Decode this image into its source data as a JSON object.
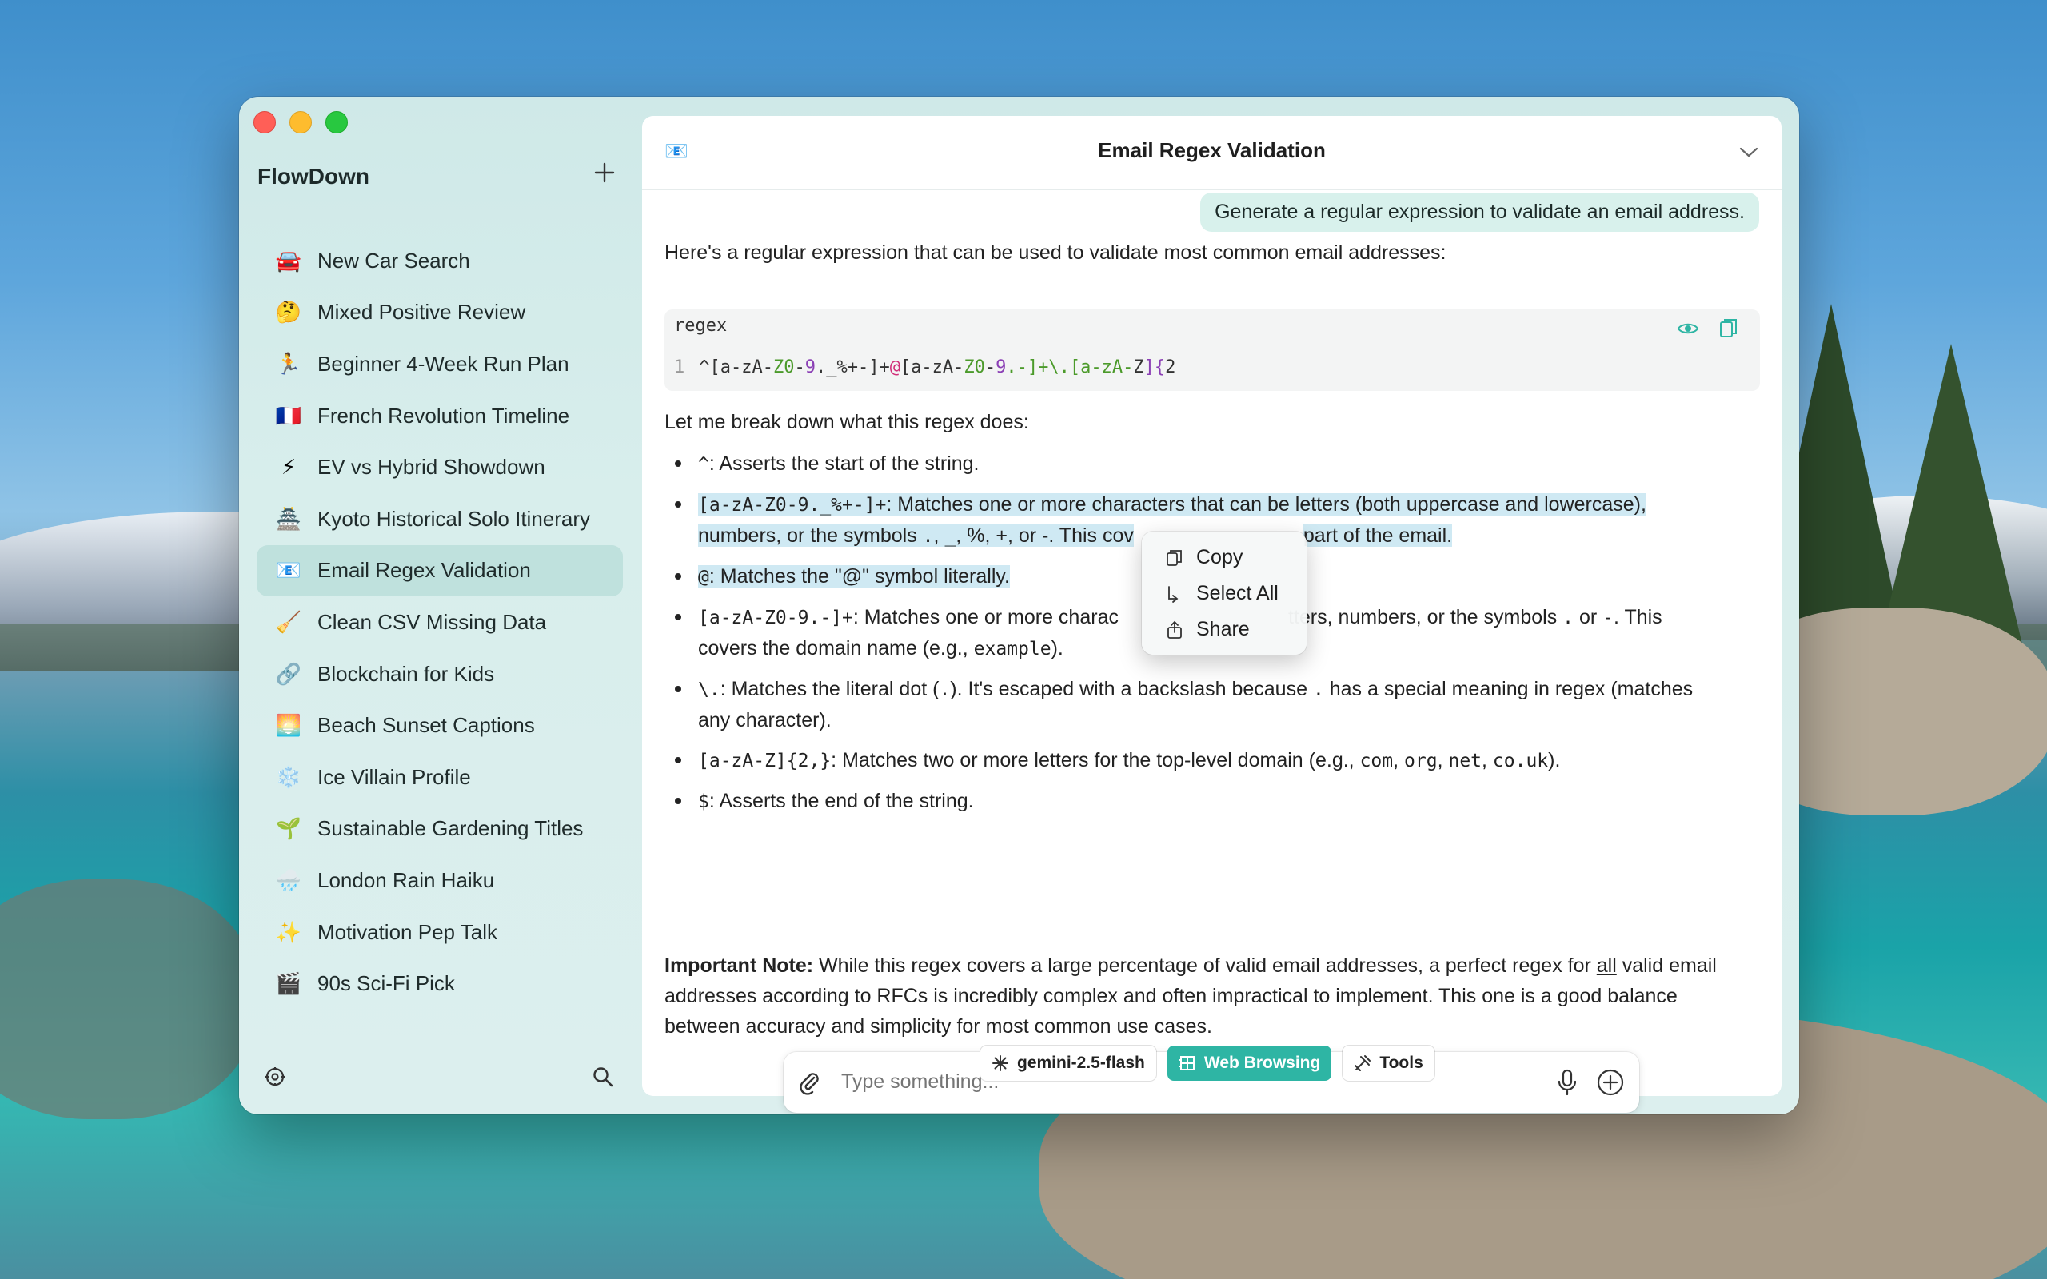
{
  "app": {
    "name": "FlowDown"
  },
  "sidebar": {
    "items": [
      {
        "emoji": "🚘",
        "label": "New Car Search"
      },
      {
        "emoji": "🤔",
        "label": "Mixed Positive Review"
      },
      {
        "emoji": "🏃",
        "label": "Beginner 4-Week Run Plan"
      },
      {
        "emoji": "🇫🇷",
        "label": "French Revolution Timeline"
      },
      {
        "emoji": "⚡",
        "label": "EV vs Hybrid Showdown"
      },
      {
        "emoji": "🏯",
        "label": "Kyoto Historical Solo Itinerary"
      },
      {
        "emoji": "📧",
        "label": "Email Regex Validation"
      },
      {
        "emoji": "🧹",
        "label": "Clean CSV Missing Data"
      },
      {
        "emoji": "🔗",
        "label": "Blockchain for Kids"
      },
      {
        "emoji": "🌅",
        "label": "Beach Sunset Captions"
      },
      {
        "emoji": "❄️",
        "label": "Ice Villain Profile"
      },
      {
        "emoji": "🌱",
        "label": "Sustainable Gardening Titles"
      },
      {
        "emoji": "🌧️",
        "label": "London Rain Haiku"
      },
      {
        "emoji": "✨",
        "label": "Motivation Pep Talk"
      },
      {
        "emoji": "🎬",
        "label": "90s Sci-Fi Pick"
      }
    ],
    "active_index": 6
  },
  "header": {
    "icon": "📧",
    "title": "Email Regex Validation"
  },
  "chat": {
    "user_message": "Generate a regular expression to validate an email address.",
    "intro": "Here's a regular expression that can be used to validate most common email addresses:",
    "code": {
      "lang": "regex",
      "line_number": "1",
      "parts": [
        "^[a-zA-",
        "Z0",
        "-",
        "9",
        "._%+-]+",
        "@",
        "[a-zA-",
        "Z0",
        "-",
        "9",
        ".-]+\\.[a-zA-",
        "Z",
        "]{",
        "2",
        ",}$"
      ]
    },
    "breakdown_intro": "Let me break down what this regex does:",
    "bullets": {
      "b1_code": "^",
      "b1_text": ": Asserts the start of the string.",
      "b2_code": "[a-zA-Z0-9._%+-]+",
      "b2_text1": ": Matches one or more characters that can be letters (both uppercase and lowercase),",
      "b2_text2a": "numbers, or the symbols ",
      "b2_dot": ".",
      "b2_sep1": ", ",
      "b2_us": "_",
      "b2_sep2": ", ",
      "b2_pct": "%",
      "b2_sep3": ", ",
      "b2_plus": "+",
      "b2_sep4": ", or ",
      "b2_minus": "-",
      "b2_text2b": ". This cov",
      "b2_text2c": "part of the email.",
      "b3_code": "@",
      "b3_text": ": Matches the \"@\" symbol literally.",
      "b4_code": "[a-zA-Z0-9.-]+",
      "b4_text1a": ": Matches one or more charac",
      "b4_text1b": "tters, numbers, or the symbols ",
      "b4_dot": ".",
      "b4_or": " or ",
      "b4_minus": "-",
      "b4_text1c": ". This",
      "b4_text2a": "covers the domain name (e.g., ",
      "b4_example": "example",
      "b4_text2b": ").",
      "b5_code": "\\.",
      "b5_text1a": ": Matches the literal dot (",
      "b5_dot": ".",
      "b5_text1b": "). It's escaped with a backslash because ",
      "b5_dot2": ".",
      "b5_text1c": " has a special meaning in regex (matches",
      "b5_text2": "any character).",
      "b6_code": "[a-zA-Z]{2,}",
      "b6_text1": ": Matches two or more letters for the top-level domain (e.g., ",
      "b6_com": "com",
      "b6_sep1": ", ",
      "b6_org": "org",
      "b6_sep2": ", ",
      "b6_net": "net",
      "b6_sep3": ", ",
      "b6_couk": "co.uk",
      "b6_text2": ").",
      "b7_code": "$",
      "b7_text": ": Asserts the end of the string."
    },
    "note_label": "Important Note:",
    "note_line1a": " While this regex covers a large percentage of valid email addresses, a perfect regex for ",
    "note_all": "all",
    "note_line1b": " valid email",
    "note_line2": "addresses according to RFCs is incredibly complex and often impractical to implement. This one is a good balance",
    "note_line3": "between accuracy and simplicity for most common use cases."
  },
  "context_menu": {
    "items": [
      {
        "label": "Copy",
        "icon": "copy-icon"
      },
      {
        "label": "Select All",
        "icon": "select-all-icon"
      },
      {
        "label": "Share",
        "icon": "share-icon"
      }
    ]
  },
  "input": {
    "placeholder": "Type something..."
  },
  "chips": {
    "model": "gemini-2.5-flash",
    "web": "Web Browsing",
    "tools": "Tools"
  },
  "colors": {
    "accent": "#2eb5a4",
    "active_item": "#bfe1dd"
  }
}
